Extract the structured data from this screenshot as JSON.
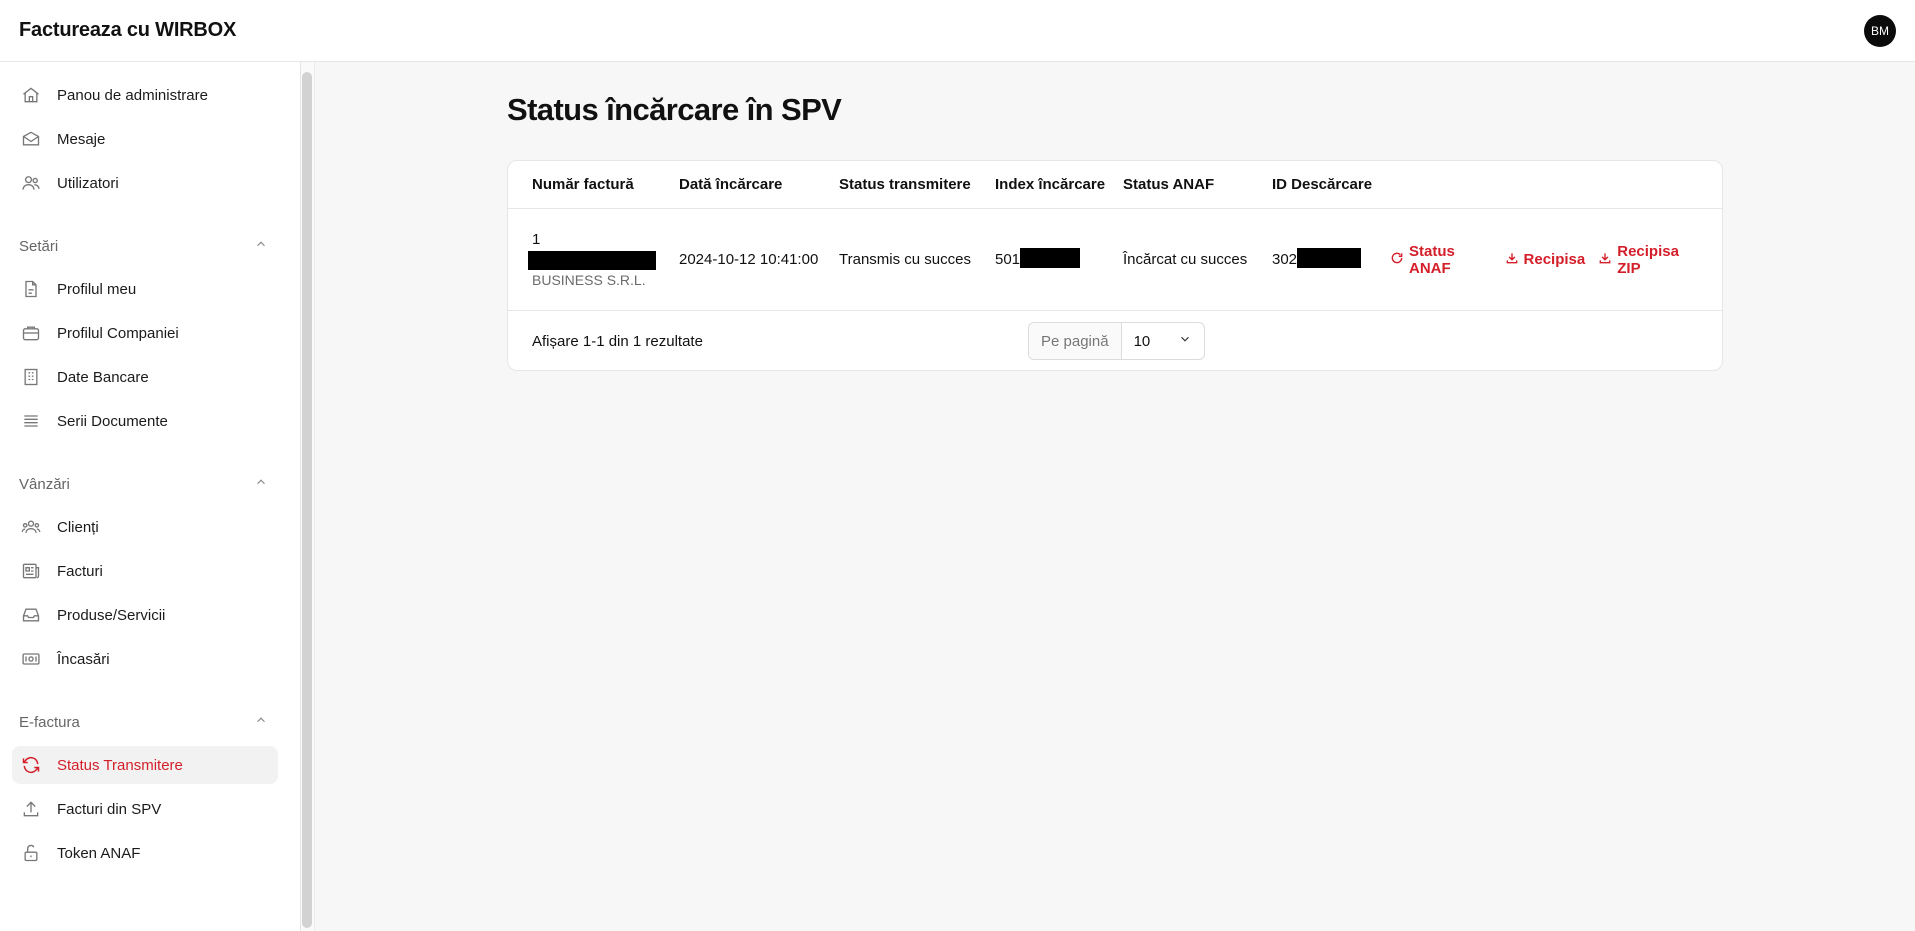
{
  "app": {
    "title": "Factureaza cu WIRBOX",
    "avatar_initials": "BM"
  },
  "sidebar": {
    "items_top": [
      {
        "label": "Panou de administrare",
        "icon": "home-icon"
      },
      {
        "label": "Mesaje",
        "icon": "mail-icon"
      },
      {
        "label": "Utilizatori",
        "icon": "users-icon"
      }
    ],
    "sections": [
      {
        "title": "Setări",
        "items": [
          {
            "label": "Profilul meu",
            "icon": "document-icon"
          },
          {
            "label": "Profilul Companiei",
            "icon": "briefcase-icon"
          },
          {
            "label": "Date Bancare",
            "icon": "building-icon"
          },
          {
            "label": "Serii Documente",
            "icon": "list-icon"
          }
        ]
      },
      {
        "title": "Vânzări",
        "items": [
          {
            "label": "Clienți",
            "icon": "group-icon"
          },
          {
            "label": "Facturi",
            "icon": "newspaper-icon"
          },
          {
            "label": "Produse/Servicii",
            "icon": "inbox-icon"
          },
          {
            "label": "Încasări",
            "icon": "cash-icon"
          }
        ]
      },
      {
        "title": "E-factura",
        "items": [
          {
            "label": "Status Transmitere",
            "icon": "refresh-icon",
            "active": true
          },
          {
            "label": "Facturi din SPV",
            "icon": "upload-icon"
          },
          {
            "label": "Token ANAF",
            "icon": "unlock-icon"
          }
        ]
      }
    ]
  },
  "main": {
    "page_title": "Status încărcare în SPV",
    "table": {
      "headers": [
        "Număr factură",
        "Dată încărcare",
        "Status transmitere",
        "Index încărcare",
        "Status ANAF",
        "ID Descărcare"
      ],
      "rows": [
        {
          "invoice_number": "1",
          "company": "BUSINESS S.R.L.",
          "upload_date": "2024-10-12 10:41:00",
          "transmit_status": "Transmis cu succes",
          "upload_index_prefix": "501",
          "anaf_status": "Încărcat cu succes",
          "download_id_prefix": "302",
          "actions": [
            "Status ANAF",
            "Recipisa",
            "Recipisa ZIP"
          ]
        }
      ]
    },
    "footer": {
      "results_text": "Afișare 1-1 din 1 rezultate",
      "per_page_label": "Pe pagină",
      "per_page_value": "10"
    }
  },
  "colors": {
    "accent": "#d41f2a",
    "text": "#111111",
    "muted": "#6b6b6b"
  }
}
